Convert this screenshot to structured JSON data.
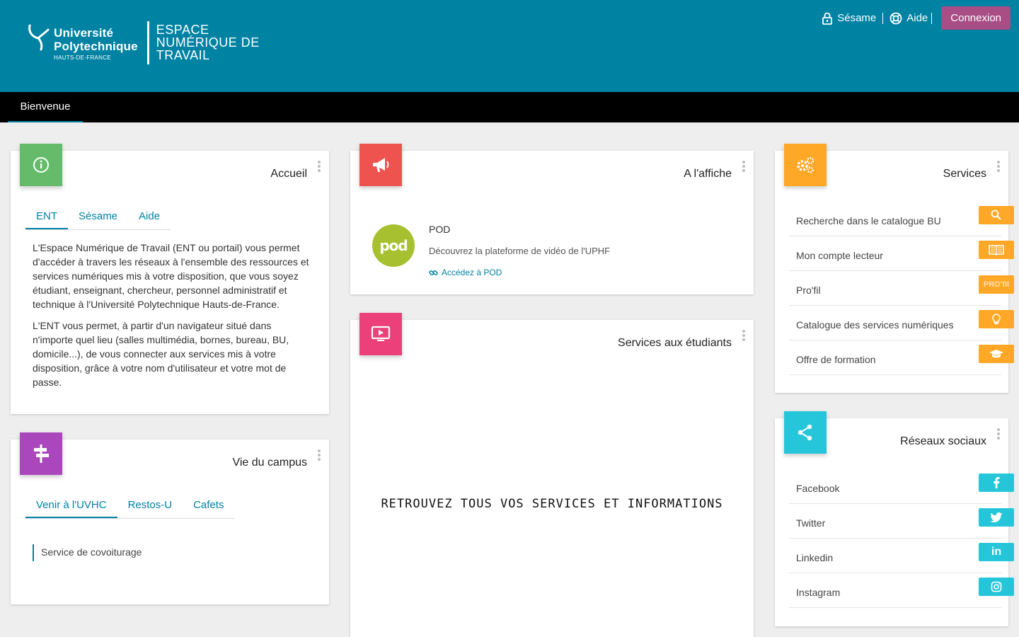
{
  "header": {
    "logo": {
      "university_line1": "Université",
      "university_line2": "Polytechnique",
      "university_line3": "HAUTS-DE-FRANCE",
      "ent_line1": "ESPACE",
      "ent_line2": "NUMÉRIQUE DE",
      "ent_line3": "TRAVAIL"
    },
    "links": {
      "sesame": "Sésame",
      "aide": "Aide",
      "connexion": "Connexion"
    }
  },
  "nav": {
    "tabs": [
      {
        "label": "Bienvenue"
      }
    ]
  },
  "accueil": {
    "title": "Accueil",
    "tabs": [
      "ENT",
      "Sésame",
      "Aide"
    ],
    "paragraph1": "L'Espace Numérique de Travail (ENT ou portail) vous permet d'accéder à travers les réseaux à l'ensemble des ressources et services numériques mis à votre disposition, que vous soyez étudiant, enseignant, chercheur, personnel administratif et technique à l'Université Polytechnique Hauts-de-France.",
    "paragraph2": "L'ENT vous permet, à partir d'un navigateur situé dans n'importe quel lieu (salles multimédia, bornes, bureau, BU, domicile...), de vous connecter aux services mis à votre disposition, grâce à votre nom d'utilisateur et votre mot de passe."
  },
  "vie_campus": {
    "title": "Vie du campus",
    "tabs": [
      "Venir à l'UVHC",
      "Restos-U",
      "Cafets"
    ],
    "item": "Service de covoiturage"
  },
  "affiche": {
    "title": "A l'affiche",
    "pod_logo_text": "pod",
    "pod_title": "POD",
    "pod_desc": "Découvrez la plateforme de vidéo de l'UPHF",
    "pod_link": "Accédez à POD"
  },
  "services_etudiants": {
    "title": "Services aux étudiants",
    "banner": "RETROUVEZ TOUS VOS SERVICES ET INFORMATIONS"
  },
  "services": {
    "title": "Services",
    "items": [
      {
        "label": "Recherche dans le catalogue BU",
        "icon": "search-icon"
      },
      {
        "label": "Mon compte lecteur",
        "icon": "book-icon"
      },
      {
        "label": "Pro'fil",
        "icon": "profil-icon",
        "badge": "PRO'fil"
      },
      {
        "label": "Catalogue des services numériques",
        "icon": "lightbulb-icon"
      },
      {
        "label": "Offre de formation",
        "icon": "graduation-cap-icon"
      }
    ]
  },
  "reseaux": {
    "title": "Réseaux sociaux",
    "items": [
      {
        "label": "Facebook",
        "icon": "facebook-icon"
      },
      {
        "label": "Twitter",
        "icon": "twitter-icon"
      },
      {
        "label": "Linkedin",
        "icon": "linkedin-icon",
        "badge": "in"
      },
      {
        "label": "Instagram",
        "icon": "instagram-icon"
      }
    ]
  },
  "colors": {
    "header": "#0082a3",
    "connexion": "#a84d86",
    "accueil_badge": "#66bb6a",
    "campus_badge": "#ab47bc",
    "affiche_badge": "#ef5350",
    "etudiants_badge": "#ec407a",
    "services_badge": "#ffa726",
    "reseaux_badge": "#26c6da"
  }
}
